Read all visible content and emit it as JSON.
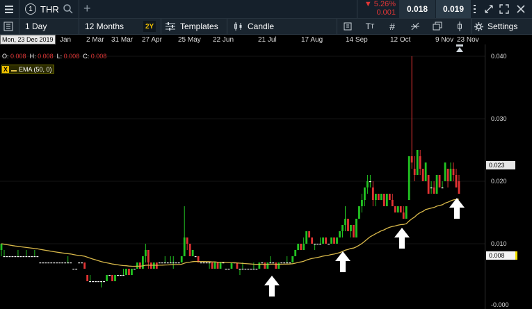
{
  "header": {
    "instrument_number": "1",
    "symbol": "THR",
    "add_label": "+",
    "change_pct": "▼ 5.26%",
    "change_abs": "0.001",
    "bid": "0.018",
    "ask": "0.019"
  },
  "toolbar": {
    "interval": "1 Day",
    "range": "12 Months",
    "range_shortcut": "2Y",
    "templates": "Templates",
    "chart_type": "Candle",
    "settings": "Settings"
  },
  "crosshair_date": "Mon, 23 Dec 2019",
  "date_axis": [
    "Jan",
    "2 Mar",
    "31 Mar",
    "27 Apr",
    "25 May",
    "22 Jun",
    "21 Jul",
    "17 Aug",
    "14 Sep",
    "12 Oct",
    "9 Nov",
    "23 Nov"
  ],
  "ohlc": {
    "o_label": "O:",
    "o": "0.008",
    "h_label": "H:",
    "h": "0.008",
    "l_label": "L:",
    "l": "0.008",
    "c_label": "C:",
    "c": "0.008"
  },
  "indicator": {
    "close": "X",
    "label": "EMA (50, 0)"
  },
  "price_axis": [
    "0.040",
    "0.030",
    "0.020",
    "0.010",
    "-0.000"
  ],
  "price_flags": {
    "last": "0.023",
    "crosshair": "0.008"
  },
  "colors": {
    "up": "#22c422",
    "down": "#e23333",
    "ema": "#d8b84a",
    "change_down": "#e23636",
    "panel": "#15202b"
  },
  "chart_data": {
    "type": "candlestick",
    "ylim": [
      0.0,
      0.042
    ],
    "series": [
      {
        "name": "THR",
        "values": [
          [
            0.009,
            0.01,
            0.008,
            0.01
          ],
          [
            0.008,
            0.009,
            0.008,
            0.008
          ],
          [
            0.008,
            0.008,
            0.008,
            0.008
          ],
          [
            0.008,
            0.008,
            0.008,
            0.008
          ],
          [
            0.008,
            0.008,
            0.008,
            0.008
          ],
          [
            0.008,
            0.008,
            0.008,
            0.008
          ],
          [
            0.008,
            0.009,
            0.008,
            0.008
          ],
          [
            0.008,
            0.008,
            0.008,
            0.008
          ],
          [
            0.008,
            0.008,
            0.008,
            0.008
          ],
          [
            0.008,
            0.009,
            0.008,
            0.008
          ],
          [
            0.008,
            0.008,
            0.008,
            0.008
          ],
          [
            0.008,
            0.008,
            0.008,
            0.008
          ],
          [
            0.008,
            0.009,
            0.008,
            0.008
          ],
          [
            0.008,
            0.008,
            0.008,
            0.008
          ],
          [
            0.007,
            0.007,
            0.007,
            0.007
          ],
          [
            0.007,
            0.007,
            0.007,
            0.007
          ],
          [
            0.007,
            0.007,
            0.007,
            0.007
          ],
          [
            0.007,
            0.007,
            0.007,
            0.007
          ],
          [
            0.007,
            0.007,
            0.007,
            0.007
          ],
          [
            0.007,
            0.007,
            0.007,
            0.007
          ],
          [
            0.007,
            0.007,
            0.007,
            0.007
          ],
          [
            0.007,
            0.007,
            0.007,
            0.007
          ],
          [
            0.007,
            0.007,
            0.007,
            0.007
          ],
          [
            0.007,
            0.007,
            0.007,
            0.007
          ],
          [
            0.007,
            0.008,
            0.007,
            0.007
          ],
          [
            0.007,
            0.007,
            0.007,
            0.007
          ],
          [
            0.006,
            0.006,
            0.006,
            0.006
          ],
          [
            0.006,
            0.006,
            0.006,
            0.006
          ],
          [
            0.007,
            0.007,
            0.007,
            0.007
          ],
          [
            0.007,
            0.007,
            0.007,
            0.007
          ],
          [
            0.007,
            0.007,
            0.006,
            0.006
          ],
          [
            0.005,
            0.005,
            0.004,
            0.004
          ],
          [
            0.004,
            0.005,
            0.004,
            0.004
          ],
          [
            0.004,
            0.004,
            0.004,
            0.004
          ],
          [
            0.004,
            0.004,
            0.004,
            0.004
          ],
          [
            0.004,
            0.004,
            0.004,
            0.004
          ],
          [
            0.004,
            0.004,
            0.003,
            0.004
          ],
          [
            0.004,
            0.004,
            0.004,
            0.004
          ],
          [
            0.004,
            0.004,
            0.004,
            0.005
          ],
          [
            0.005,
            0.005,
            0.005,
            0.005
          ],
          [
            0.005,
            0.005,
            0.004,
            0.004
          ],
          [
            0.004,
            0.005,
            0.004,
            0.005
          ],
          [
            0.005,
            0.005,
            0.005,
            0.005
          ],
          [
            0.005,
            0.005,
            0.005,
            0.005
          ],
          [
            0.005,
            0.006,
            0.005,
            0.005
          ],
          [
            0.005,
            0.006,
            0.005,
            0.006
          ],
          [
            0.006,
            0.006,
            0.005,
            0.005
          ],
          [
            0.005,
            0.006,
            0.005,
            0.006
          ],
          [
            0.006,
            0.006,
            0.006,
            0.006
          ],
          [
            0.006,
            0.007,
            0.006,
            0.007
          ],
          [
            0.007,
            0.007,
            0.006,
            0.006
          ],
          [
            0.006,
            0.008,
            0.006,
            0.008
          ],
          [
            0.008,
            0.01,
            0.007,
            0.009
          ],
          [
            0.009,
            0.009,
            0.006,
            0.007
          ],
          [
            0.007,
            0.007,
            0.006,
            0.006
          ],
          [
            0.006,
            0.007,
            0.006,
            0.007
          ],
          [
            0.007,
            0.007,
            0.006,
            0.006
          ],
          [
            0.007,
            0.007,
            0.007,
            0.007
          ],
          [
            0.007,
            0.007,
            0.007,
            0.007
          ],
          [
            0.007,
            0.008,
            0.007,
            0.007
          ],
          [
            0.007,
            0.007,
            0.007,
            0.007
          ],
          [
            0.007,
            0.008,
            0.007,
            0.007
          ],
          [
            0.007,
            0.008,
            0.006,
            0.007
          ],
          [
            0.007,
            0.007,
            0.007,
            0.007
          ],
          [
            0.007,
            0.007,
            0.007,
            0.007
          ],
          [
            0.007,
            0.008,
            0.007,
            0.008
          ],
          [
            0.008,
            0.016,
            0.008,
            0.011
          ],
          [
            0.011,
            0.011,
            0.009,
            0.01
          ],
          [
            0.01,
            0.01,
            0.008,
            0.008
          ],
          [
            0.008,
            0.009,
            0.008,
            0.009
          ],
          [
            0.008,
            0.008,
            0.008,
            0.008
          ],
          [
            0.008,
            0.008,
            0.007,
            0.007
          ],
          [
            0.007,
            0.007,
            0.007,
            0.007
          ],
          [
            0.007,
            0.007,
            0.007,
            0.007
          ],
          [
            0.007,
            0.007,
            0.007,
            0.007
          ],
          [
            0.007,
            0.007,
            0.006,
            0.007
          ],
          [
            0.007,
            0.007,
            0.006,
            0.006
          ],
          [
            0.006,
            0.007,
            0.006,
            0.007
          ],
          [
            0.007,
            0.007,
            0.006,
            0.006
          ],
          [
            0.006,
            0.007,
            0.006,
            0.007
          ],
          [
            0.007,
            0.007,
            0.007,
            0.007
          ],
          [
            0.006,
            0.006,
            0.006,
            0.006
          ],
          [
            0.006,
            0.006,
            0.006,
            0.006
          ],
          [
            0.006,
            0.007,
            0.006,
            0.007
          ],
          [
            0.007,
            0.007,
            0.007,
            0.007
          ],
          [
            0.007,
            0.007,
            0.006,
            0.006
          ],
          [
            0.006,
            0.006,
            0.005,
            0.006
          ],
          [
            0.006,
            0.007,
            0.006,
            0.006
          ],
          [
            0.006,
            0.006,
            0.006,
            0.006
          ],
          [
            0.006,
            0.006,
            0.006,
            0.006
          ],
          [
            0.006,
            0.006,
            0.006,
            0.006
          ],
          [
            0.006,
            0.007,
            0.006,
            0.006
          ],
          [
            0.006,
            0.006,
            0.006,
            0.006
          ],
          [
            0.006,
            0.007,
            0.006,
            0.007
          ],
          [
            0.007,
            0.007,
            0.007,
            0.007
          ],
          [
            0.007,
            0.007,
            0.006,
            0.006
          ],
          [
            0.006,
            0.007,
            0.006,
            0.007
          ],
          [
            0.007,
            0.008,
            0.007,
            0.007
          ],
          [
            0.007,
            0.007,
            0.007,
            0.007
          ],
          [
            0.007,
            0.007,
            0.006,
            0.006
          ],
          [
            0.006,
            0.007,
            0.006,
            0.007
          ],
          [
            0.007,
            0.007,
            0.007,
            0.007
          ],
          [
            0.007,
            0.007,
            0.007,
            0.007
          ],
          [
            0.007,
            0.008,
            0.007,
            0.007
          ],
          [
            0.007,
            0.007,
            0.007,
            0.007
          ],
          [
            0.007,
            0.008,
            0.007,
            0.008
          ],
          [
            0.008,
            0.009,
            0.008,
            0.009
          ],
          [
            0.009,
            0.01,
            0.009,
            0.01
          ],
          [
            0.01,
            0.01,
            0.009,
            0.009
          ],
          [
            0.009,
            0.011,
            0.009,
            0.01
          ],
          [
            0.01,
            0.012,
            0.01,
            0.012
          ],
          [
            0.012,
            0.012,
            0.011,
            0.011
          ],
          [
            0.011,
            0.011,
            0.01,
            0.01
          ],
          [
            0.01,
            0.01,
            0.009,
            0.01
          ],
          [
            0.01,
            0.01,
            0.01,
            0.01
          ],
          [
            0.01,
            0.011,
            0.01,
            0.01
          ],
          [
            0.01,
            0.011,
            0.01,
            0.011
          ],
          [
            0.011,
            0.011,
            0.01,
            0.01
          ],
          [
            0.01,
            0.01,
            0.01,
            0.01
          ],
          [
            0.01,
            0.011,
            0.01,
            0.011
          ],
          [
            0.011,
            0.011,
            0.01,
            0.01
          ],
          [
            0.01,
            0.011,
            0.01,
            0.011
          ],
          [
            0.011,
            0.012,
            0.011,
            0.012
          ],
          [
            0.012,
            0.013,
            0.011,
            0.013
          ],
          [
            0.013,
            0.016,
            0.012,
            0.014
          ],
          [
            0.014,
            0.014,
            0.012,
            0.012
          ],
          [
            0.012,
            0.013,
            0.011,
            0.013
          ],
          [
            0.013,
            0.013,
            0.011,
            0.011
          ],
          [
            0.011,
            0.014,
            0.011,
            0.014
          ],
          [
            0.014,
            0.016,
            0.014,
            0.016
          ],
          [
            0.016,
            0.018,
            0.015,
            0.017
          ],
          [
            0.017,
            0.019,
            0.016,
            0.019
          ],
          [
            0.019,
            0.021,
            0.018,
            0.02
          ],
          [
            0.02,
            0.021,
            0.019,
            0.02
          ],
          [
            0.019,
            0.02,
            0.016,
            0.017
          ],
          [
            0.017,
            0.018,
            0.016,
            0.018
          ],
          [
            0.018,
            0.018,
            0.017,
            0.017
          ],
          [
            0.017,
            0.018,
            0.017,
            0.018
          ],
          [
            0.018,
            0.018,
            0.016,
            0.016
          ],
          [
            0.016,
            0.018,
            0.016,
            0.018
          ],
          [
            0.018,
            0.018,
            0.017,
            0.017
          ],
          [
            0.017,
            0.018,
            0.016,
            0.016
          ],
          [
            0.016,
            0.016,
            0.015,
            0.015
          ],
          [
            0.015,
            0.016,
            0.015,
            0.016
          ],
          [
            0.016,
            0.016,
            0.015,
            0.015
          ],
          [
            0.015,
            0.016,
            0.014,
            0.014
          ],
          [
            0.014,
            0.016,
            0.014,
            0.016
          ],
          [
            0.017,
            0.024,
            0.017,
            0.024
          ],
          [
            0.024,
            0.04,
            0.022,
            0.023
          ],
          [
            0.022,
            0.024,
            0.02,
            0.021
          ],
          [
            0.021,
            0.025,
            0.021,
            0.025
          ],
          [
            0.024,
            0.025,
            0.021,
            0.022
          ],
          [
            0.022,
            0.022,
            0.02,
            0.02
          ],
          [
            0.02,
            0.023,
            0.02,
            0.023
          ],
          [
            0.021,
            0.021,
            0.018,
            0.018
          ],
          [
            0.019,
            0.02,
            0.018,
            0.019
          ],
          [
            0.019,
            0.02,
            0.018,
            0.018
          ],
          [
            0.018,
            0.021,
            0.018,
            0.021
          ],
          [
            0.021,
            0.021,
            0.019,
            0.019
          ],
          [
            0.019,
            0.02,
            0.019,
            0.019
          ],
          [
            0.02,
            0.023,
            0.02,
            0.023
          ],
          [
            0.022,
            0.022,
            0.019,
            0.02
          ],
          [
            0.02,
            0.023,
            0.02,
            0.022
          ],
          [
            0.022,
            0.023,
            0.02,
            0.021
          ],
          [
            0.021,
            0.022,
            0.019,
            0.019
          ],
          [
            0.02,
            0.021,
            0.018,
            0.018
          ]
        ]
      }
    ],
    "overlay": {
      "name": "EMA (50, 0)"
    }
  }
}
